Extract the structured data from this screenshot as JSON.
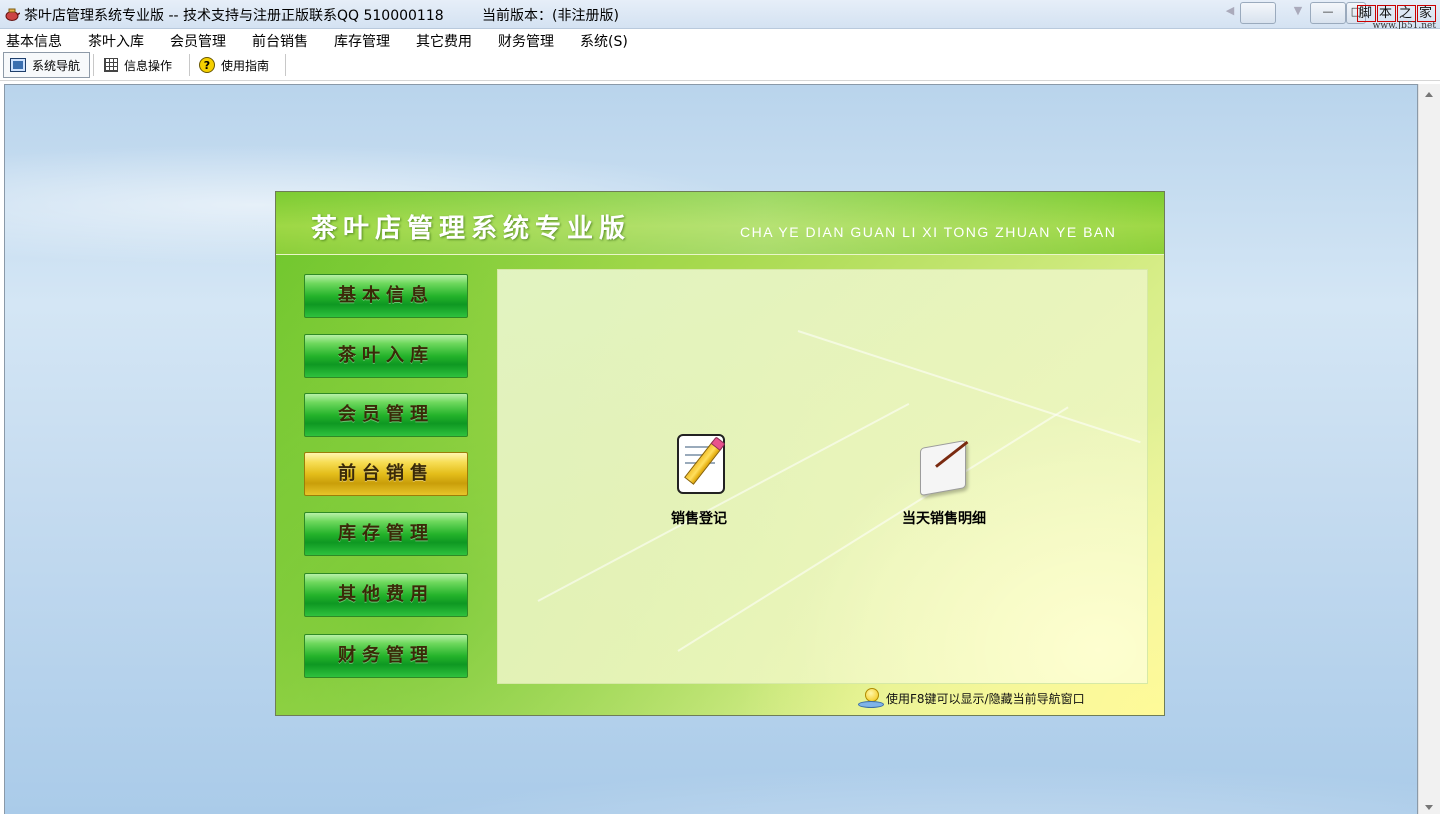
{
  "window": {
    "title": "茶叶店管理系统专业版 -- 技术支持与注册正版联系QQ 510000118",
    "version": "当前版本：(非注册版)",
    "controls": [
      "—",
      "□",
      "X"
    ]
  },
  "watermark": {
    "brand_chars": [
      "脚",
      "本",
      "之",
      "家"
    ],
    "url": "www.Jb51.net"
  },
  "menubar": {
    "items": [
      "基本信息",
      "茶叶入库",
      "会员管理",
      "前台销售",
      "库存管理",
      "其它费用",
      "财务管理",
      "系统(S)"
    ]
  },
  "toolbar": {
    "buttons": [
      {
        "label": "系统导航",
        "icon": "monitor-icon",
        "active": true
      },
      {
        "label": "信息操作",
        "icon": "grid-icon",
        "active": false
      },
      {
        "label": "使用指南",
        "icon": "help-icon",
        "active": false
      }
    ]
  },
  "nav_panel": {
    "title": "茶叶店管理系统专业版",
    "subtitle": "CHA YE DIAN GUAN LI XI TONG ZHUAN YE BAN",
    "buttons": [
      {
        "label": "基本信息",
        "selected": false
      },
      {
        "label": "茶叶入库",
        "selected": false
      },
      {
        "label": "会员管理",
        "selected": false
      },
      {
        "label": "前台销售",
        "selected": true
      },
      {
        "label": "库存管理",
        "selected": false
      },
      {
        "label": "其他费用",
        "selected": false
      },
      {
        "label": "财务管理",
        "selected": false
      }
    ],
    "functions": [
      {
        "label": "销售登记",
        "icon": "pencil-document-icon"
      },
      {
        "label": "当天销售明细",
        "icon": "scroll-quill-icon"
      }
    ],
    "hint": "使用F8键可以显示/隐藏当前导航窗口"
  },
  "colors": {
    "green_button": "#25b32b",
    "selected_button": "#e3bd1a",
    "panel_green": "#8ccf3a"
  }
}
